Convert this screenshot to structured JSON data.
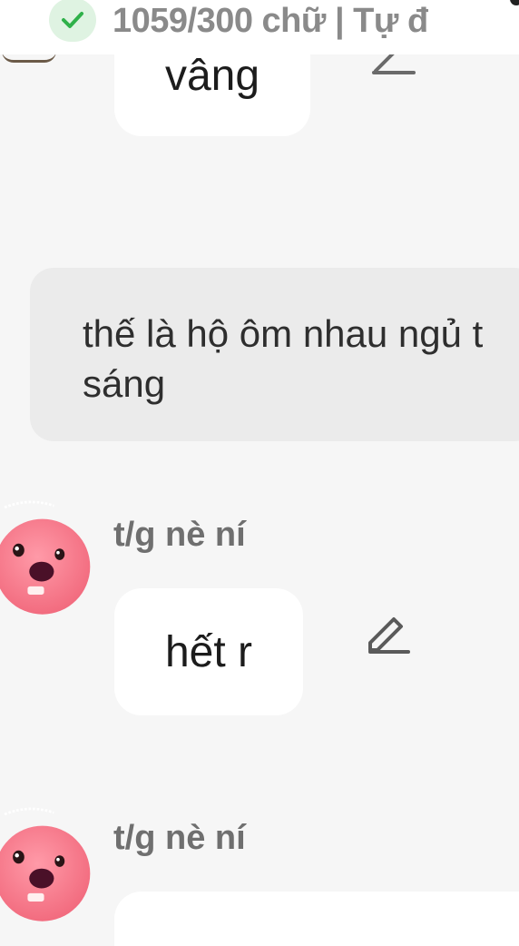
{
  "status_bar": {
    "counter_text": "1059/300 chữ | Tự đ",
    "check_icon": "check-circle-icon",
    "accent_color": "#2fb14a"
  },
  "messages": [
    {
      "id": "m1",
      "type": "bot",
      "text": "vâng",
      "edit_icon": "pencil-edit-icon"
    },
    {
      "id": "m2",
      "type": "user",
      "text": "thế là hộ ôm nhau ngủ t\nsáng"
    },
    {
      "id": "m3",
      "type": "bot",
      "sender": "t/g nè ní",
      "text": "hết r",
      "avatar_icon": "pink-creature-avatar",
      "edit_icon": "pencil-edit-icon"
    },
    {
      "id": "m4",
      "type": "bot",
      "sender": "t/g nè ní",
      "text": "",
      "avatar_icon": "pink-creature-avatar"
    }
  ]
}
